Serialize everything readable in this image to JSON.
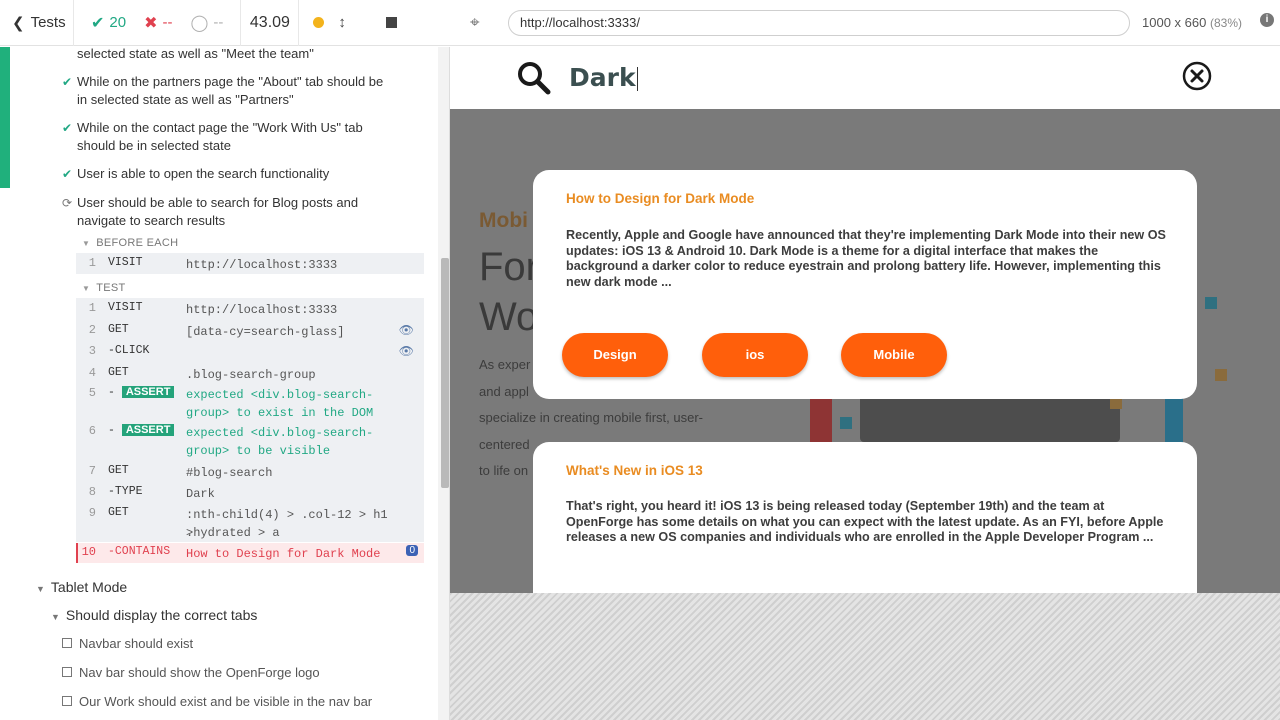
{
  "topbar": {
    "tests_label": "Tests",
    "passed": "20",
    "failed": "--",
    "pending": "--",
    "duration": "43.09"
  },
  "reporter": {
    "prev_item": "selected state as well as \"Meet the team\"",
    "items": [
      {
        "text_1": "While on the partners page the \"About\" tab should be",
        "text_2": "in selected state as well as \"Partners\""
      },
      {
        "text_1": "While on the contact page the \"Work With Us\" tab",
        "text_2": "should be in selected state"
      },
      {
        "text_1": "User is able to open the search functionality"
      },
      {
        "text_1": "User should be able to search for Blog posts and",
        "text_2": "navigate to search results"
      }
    ],
    "before_each_label": "BEFORE EACH",
    "test_label": "TEST",
    "before_each_cmds": [
      {
        "num": "1",
        "name": "VISIT",
        "msg": "http://localhost:3333"
      }
    ],
    "test_cmds": [
      {
        "num": "1",
        "name": "VISIT",
        "msg": "http://localhost:3333"
      },
      {
        "num": "2",
        "name": "GET",
        "msg": "[data-cy=search-glass]"
      },
      {
        "num": "3",
        "name": "-CLICK",
        "msg": ""
      },
      {
        "num": "4",
        "name": "GET",
        "msg": ".blog-search-group"
      },
      {
        "num": "5",
        "name": "-",
        "badge": "ASSERT",
        "msg_1": "expected <div.blog-search-",
        "msg_2": "group> to exist in the DOM"
      },
      {
        "num": "6",
        "name": "-",
        "badge": "ASSERT",
        "msg_1": "expected <div.blog-search-",
        "msg_2": "group> to be visible"
      },
      {
        "num": "7",
        "name": "GET",
        "msg": "#blog-search"
      },
      {
        "num": "8",
        "name": "-TYPE",
        "msg": "Dark"
      },
      {
        "num": "9",
        "name": "GET",
        "msg_1": ":nth-child(4) > .col-12 > h1 >",
        "msg_2": ".hydrated > a"
      },
      {
        "num": "10",
        "name": "-CONTAINS",
        "msg": "How to Design for Dark Mode",
        "count": "0"
      }
    ],
    "suite_tablet": "Tablet Mode",
    "suite_tabs": "Should display the correct tabs",
    "pending_items": [
      "Navbar should exist",
      "Nav bar should show the OpenForge logo",
      "Our Work should exist and be visible in the nav bar"
    ]
  },
  "browser": {
    "url": "http://localhost:3333/",
    "viewport": "1000 x 660",
    "zoom": "(83%)"
  },
  "aut": {
    "search_value": "Dark",
    "bg_heading_small": "Mobi",
    "bg_heading_1": "For",
    "bg_heading_2": "Wo",
    "bg_lines": [
      "As exper",
      "and appl",
      "specialize in creating mobile first, user-",
      "centered",
      "to life on"
    ],
    "cards": [
      {
        "title": "How to Design for Dark Mode",
        "body": "Recently, Apple and Google have announced that they're implementing Dark Mode into their new OS updates: iOS 13 & Android 10. Dark Mode is a theme for a digital interface that makes the background a darker color to reduce eyestrain and prolong battery life. However, implementing this new dark mode ...",
        "tags": [
          "Design",
          "ios",
          "Mobile"
        ]
      },
      {
        "title": "What's New in iOS 13",
        "body": "That's right, you heard it! iOS 13 is being released today (September 19th) and the team at OpenForge has some details on what you can expect with the latest update. As an FYI, before Apple releases a new OS companies and individuals who are enrolled in the Apple Developer Program ..."
      }
    ]
  },
  "colors": {
    "pass": "#21a884",
    "fail": "#e0414f",
    "accent_orange": "#ff5f0b",
    "card_title": "#e98c22"
  }
}
